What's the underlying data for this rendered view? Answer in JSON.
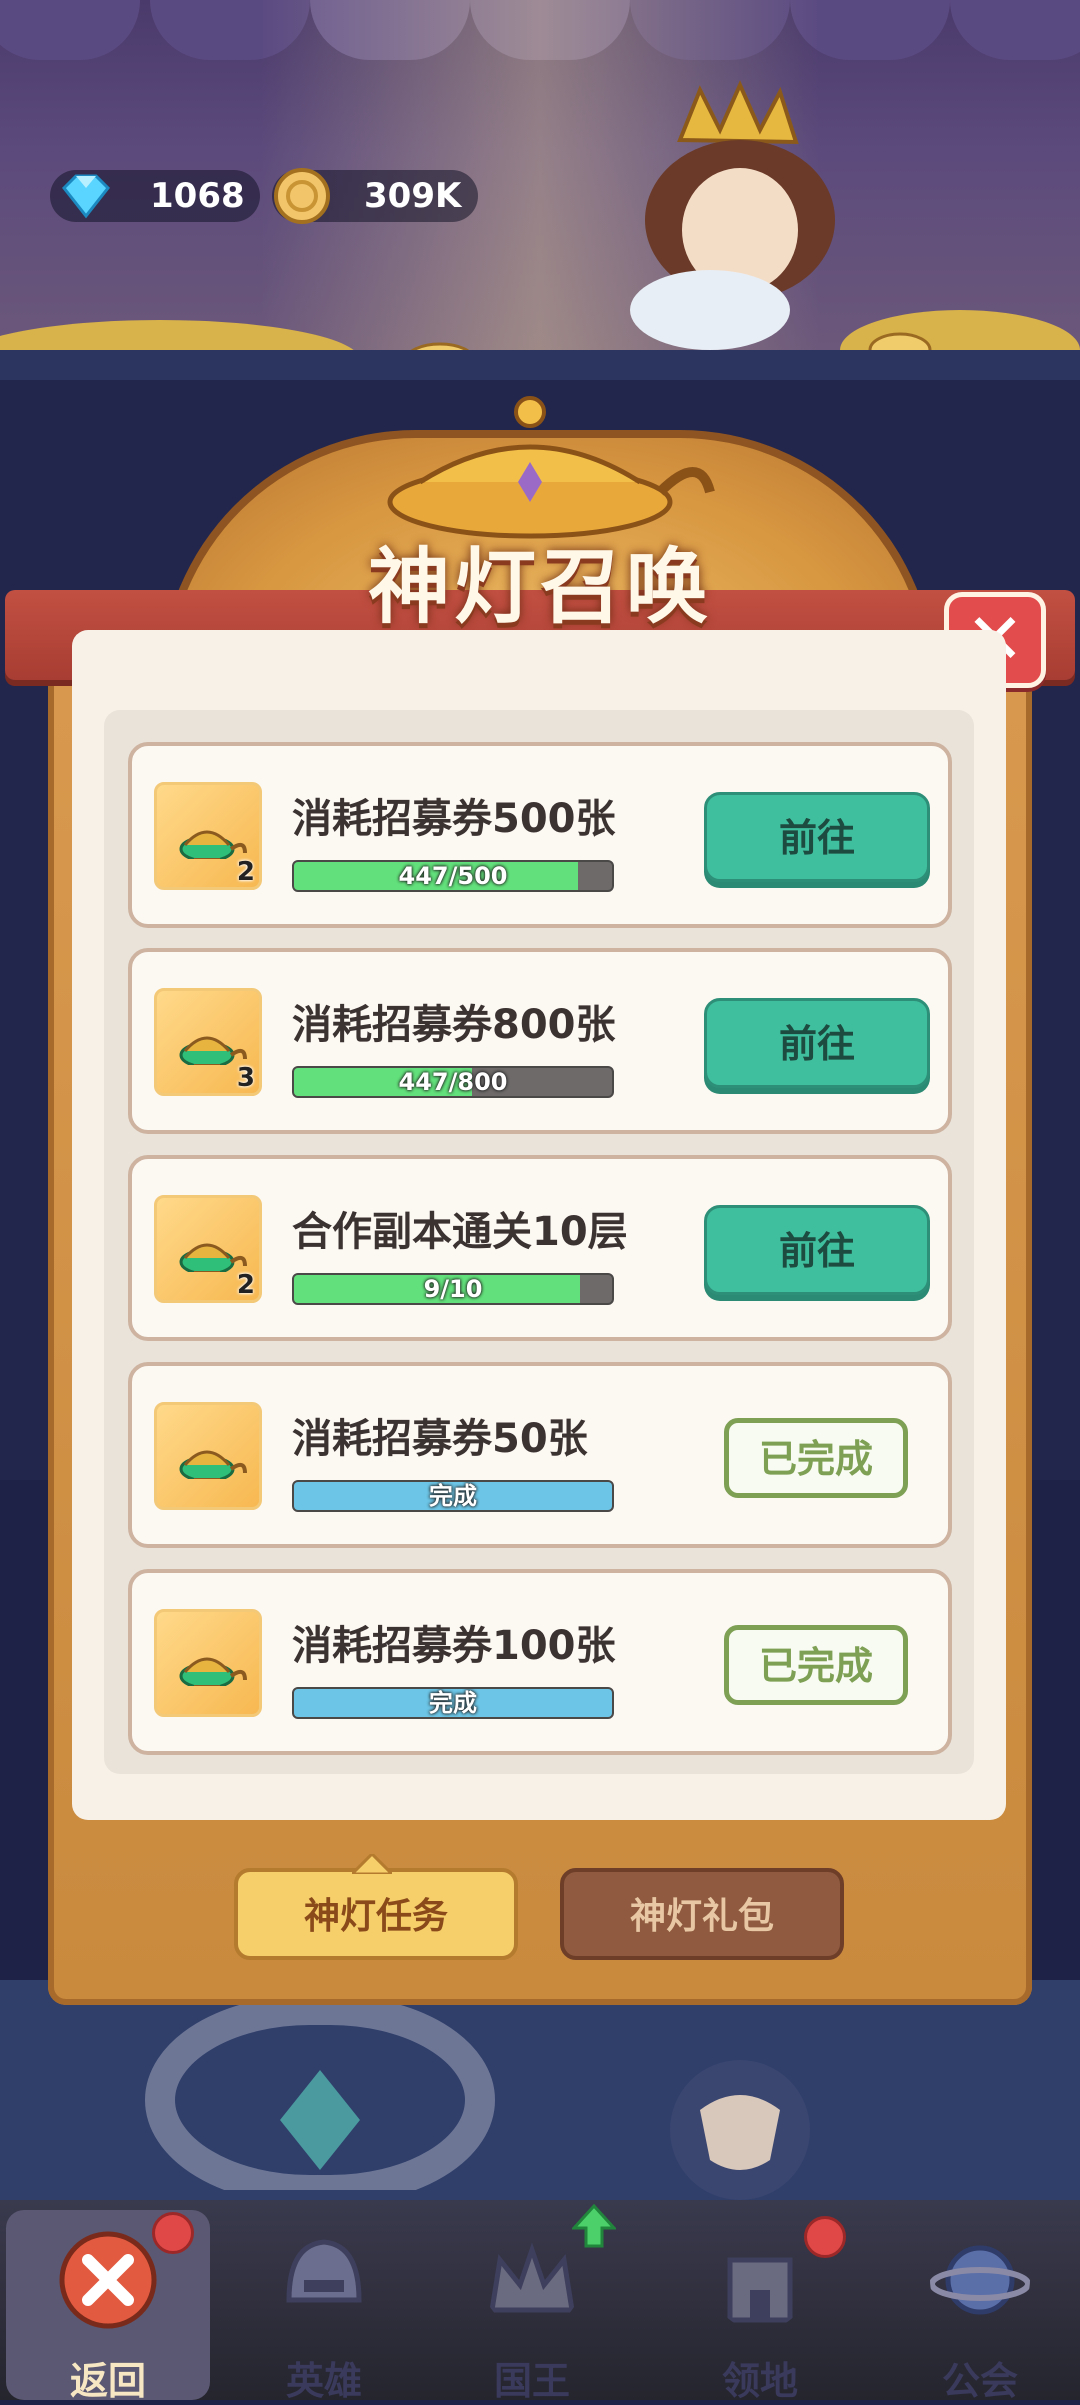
{
  "currency": {
    "diamonds": {
      "icon": "diamond-icon",
      "value": "1068"
    },
    "gold": {
      "icon": "gold-coin-icon",
      "value": "309K"
    }
  },
  "panel": {
    "title": "神灯召唤",
    "close_icon": "close-icon",
    "tasks": [
      {
        "icon": "magic-lamp-icon",
        "count": "2",
        "name": "消耗招募券500张",
        "progress_text": "447/500",
        "progress": 0.894,
        "action": "前往",
        "completed": false
      },
      {
        "icon": "magic-lamp-icon",
        "count": "3",
        "name": "消耗招募券800张",
        "progress_text": "447/800",
        "progress": 0.559,
        "action": "前往",
        "completed": false
      },
      {
        "icon": "magic-lamp-icon",
        "count": "2",
        "name": "合作副本通关10层",
        "progress_text": "9/10",
        "progress": 0.9,
        "action": "前往",
        "completed": false
      },
      {
        "icon": "magic-lamp-icon",
        "count": "",
        "name": "消耗招募券50张",
        "progress_text": "完成",
        "progress": 1,
        "action": "已完成",
        "completed": true
      },
      {
        "icon": "magic-lamp-icon",
        "count": "",
        "name": "消耗招募券100张",
        "progress_text": "完成",
        "progress": 1,
        "action": "已完成",
        "completed": true
      }
    ],
    "tabs": [
      {
        "label": "神灯任务",
        "active": true
      },
      {
        "label": "神灯礼包",
        "active": false
      }
    ]
  },
  "nav": [
    {
      "label": "返回",
      "icon": "close-icon",
      "badge": true
    },
    {
      "label": "英雄",
      "icon": "helmet-icon",
      "badge": false
    },
    {
      "label": "国王",
      "icon": "crown-icon",
      "badge": false,
      "upgrade": true
    },
    {
      "label": "领地",
      "icon": "castle-icon",
      "badge": true
    },
    {
      "label": "公会",
      "icon": "planet-icon",
      "badge": false
    }
  ],
  "colors": {
    "go_button": "#3fbf9e",
    "progress_green": "#62e07b",
    "progress_done": "#6cc5e6",
    "banner_red": "#c25042"
  }
}
